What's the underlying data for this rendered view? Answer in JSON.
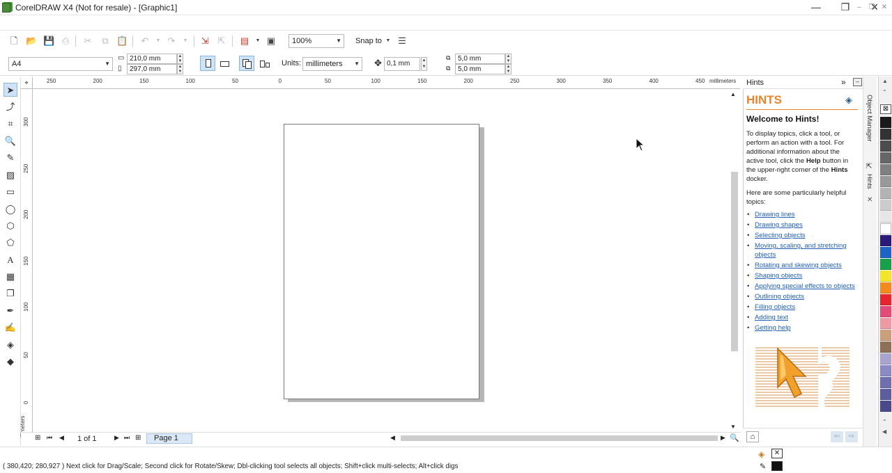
{
  "window": {
    "title": "CorelDRAW X4 (Not for resale) - [Graphic1]",
    "minimize": "—",
    "restore": "❐",
    "close": "✕"
  },
  "toolbar": {
    "zoom": "100%",
    "snap_to": "Snap to"
  },
  "property_bar": {
    "page_size": "A4",
    "width": "210,0 mm",
    "height": "297,0 mm",
    "units_label": "Units:",
    "units_value": "millimeters",
    "nudge": "0,1 mm",
    "dup_x": "5,0 mm",
    "dup_y": "5,0 mm"
  },
  "ruler": {
    "h_labels": [
      "250",
      "200",
      "150",
      "100",
      "50",
      "0",
      "50",
      "100",
      "150",
      "200",
      "250",
      "300",
      "350",
      "400",
      "450"
    ],
    "h_unit": "millimeters",
    "v_labels": [
      "300",
      "250",
      "200",
      "150",
      "100",
      "50",
      "0"
    ],
    "v_unit": "millimeters"
  },
  "page_nav": {
    "count": "1 of 1",
    "tab": "Page 1"
  },
  "hints": {
    "docker_title": "Hints",
    "heading": "HINTS",
    "welcome": "Welcome to Hints!",
    "para1_a": "To display topics, click a tool, or perform an action with a tool. For additional information about the active tool, click the ",
    "para1_help": "Help",
    "para1_b": " button in the upper-right corner of the ",
    "para1_hints": "Hints",
    "para1_c": " docker.",
    "para2": "Here are some particularly helpful topics:",
    "topics": [
      "Drawing lines",
      "Drawing shapes",
      "Selecting objects",
      "Moving, scaling, and stretching objects",
      "Rotating and skewing objects",
      "Shaping objects",
      "Applying special effects to objects",
      "Outlining objects",
      "Filling objects",
      "Adding text",
      "Getting help"
    ]
  },
  "side_tabs": {
    "object_manager": "Object Manager",
    "hints": "Hints"
  },
  "palette": {
    "colors": [
      "#1a1a1a",
      "#333333",
      "#4d4d4d",
      "#666666",
      "#808080",
      "#999999",
      "#b3b3b3",
      "#cccccc",
      "#e6e6e6",
      "#ffffff",
      "#2b1a7a",
      "#1f63c8",
      "#18a14b",
      "#f3e62a",
      "#f48a1e",
      "#e8252e",
      "#e34a7a",
      "#ee9aa5",
      "#c9a07a",
      "#8f6f55",
      "#a8a3cf",
      "#8c8ac4",
      "#6f6fb0",
      "#5c5c9e",
      "#4a4a8a"
    ]
  },
  "status": {
    "text": "( 380,420; 280,927 )   Next click for Drag/Scale; Second click for Rotate/Skew; Dbl-clicking tool selects all objects; Shift+click multi-selects; Alt+click digs"
  }
}
